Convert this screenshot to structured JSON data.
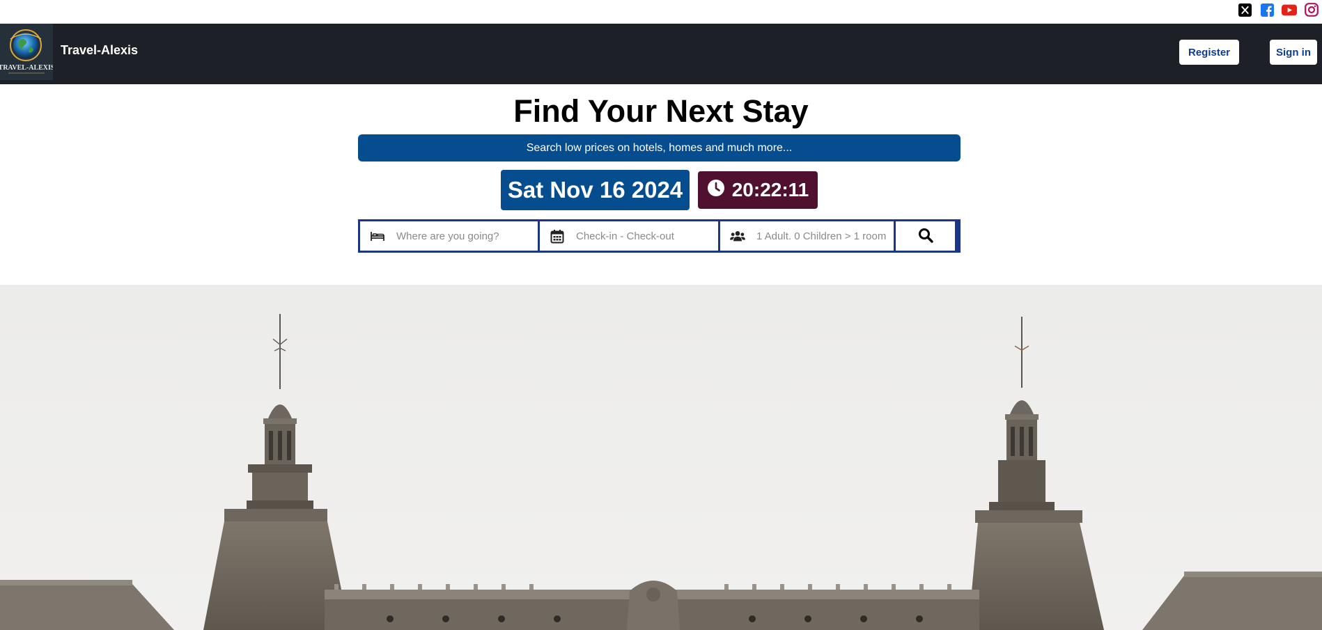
{
  "social": {
    "items": [
      {
        "icon": "x-twitter-icon",
        "color": "#000000"
      },
      {
        "icon": "facebook-icon",
        "color": "#1877f2"
      },
      {
        "icon": "youtube-icon",
        "color": "#e62117"
      },
      {
        "icon": "instagram-icon",
        "color": "#b0135c"
      }
    ]
  },
  "navbar": {
    "logo_text": "TRAVEL-ALEXIS",
    "brand": "Travel-Alexis",
    "register_label": "Register",
    "signin_label": "Sign in",
    "background": "#1e2028",
    "button_text_color": "#113d8e"
  },
  "hero": {
    "title": "Find Your Next Stay",
    "subtitle": "Search low prices on hotels, homes and much more...",
    "date": "Sat Nov 16 2024",
    "time": "20:22:11",
    "date_bg": "#064d8f",
    "time_bg": "#501131"
  },
  "search": {
    "destination_placeholder": "Where are you going?",
    "dates_placeholder": "Check-in - Check-out",
    "guests_placeholder": "1 Adult. 0 Children > 1 room",
    "border_color": "#1b3687"
  }
}
